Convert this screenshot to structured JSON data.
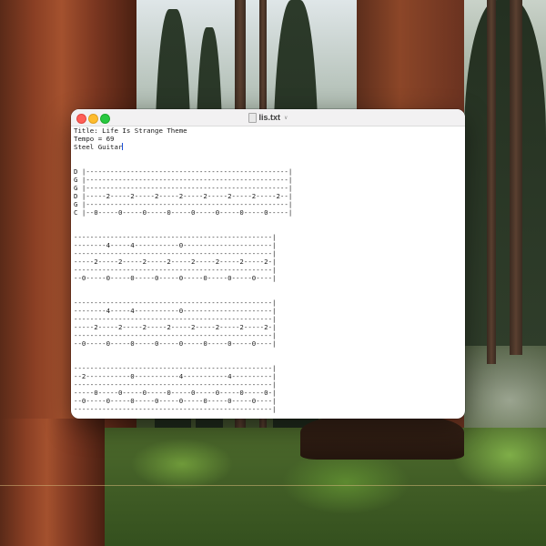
{
  "window": {
    "title": "lis.txt",
    "title_chevron": "∨"
  },
  "document": {
    "lines": [
      "Title: Life Is Strange Theme",
      "Tempo = 69",
      "Steel Guitar",
      "",
      "",
      "D |--------------------------------------------------|",
      "G |--------------------------------------------------|",
      "G |--------------------------------------------------|",
      "D |-----2-----2-----2-----2-----2-----2-----2-----2--|",
      "G |--------------------------------------------------|",
      "C |--0-----0-----0-----0-----0-----0-----0-----0-----|",
      "",
      "",
      "-------------------------------------------------|",
      "--------4-----4-----------0----------------------|",
      "-------------------------------------------------|",
      "-----2-----2-----2-----2-----2-----2-----2-----2-|",
      "-------------------------------------------------|",
      "--0-----0-----0-----0-----0-----0-----0-----0----|",
      "",
      "",
      "-------------------------------------------------|",
      "--------4-----4-----------0----------------------|",
      "-------------------------------------------------|",
      "-----2-----2-----2-----2-----2-----2-----2-----2-|",
      "-------------------------------------------------|",
      "--0-----0-----0-----0-----0-----0-----0-----0----|",
      "",
      "",
      "-------------------------------------------------|",
      "--2-----------0-----------4-----------4----------|",
      "-------------------------------------------------|",
      "-----0-----0-----0-----0-----0-----0-----0-----0-|",
      "--0-----0-----0-----0-----0-----0-----0-----0----|",
      "-------------------------------------------------|"
    ]
  }
}
